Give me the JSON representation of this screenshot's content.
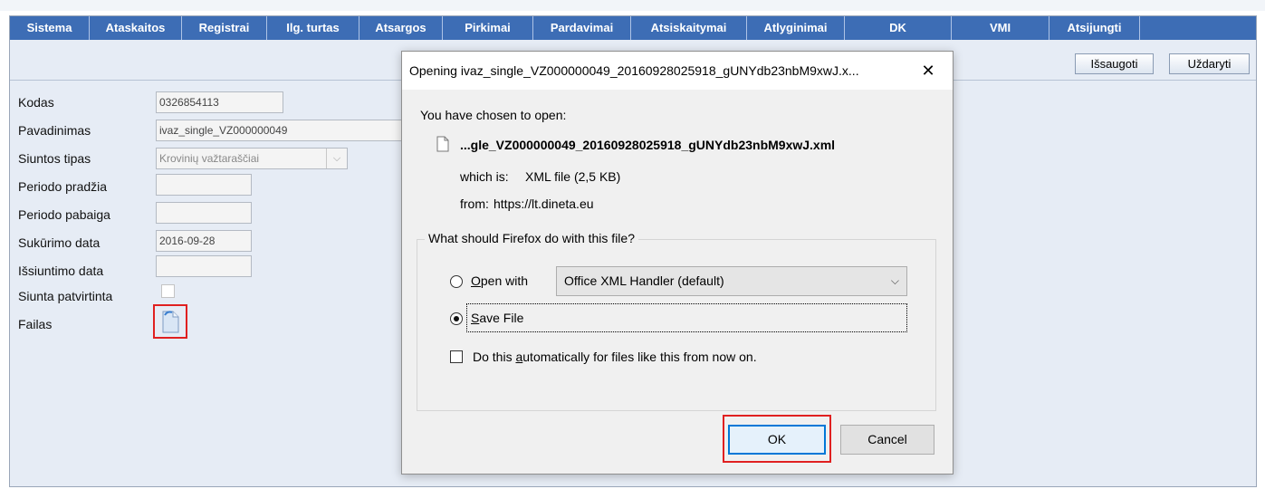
{
  "menu": [
    "Sistema",
    "Ataskaitos",
    "Registrai",
    "Ilg. turtas",
    "Atsargos",
    "Pirkimai",
    "Pardavimai",
    "Atsiskaitymai",
    "Atlyginimai",
    "DK",
    "VMI",
    "Atsijungti"
  ],
  "toolbar": {
    "save_label": "Išsaugoti",
    "close_label": "Uždaryti"
  },
  "form": {
    "kodas_label": "Kodas",
    "kodas_value": "0326854113",
    "pavadinimas_label": "Pavadinimas",
    "pavadinimas_value": "ivaz_single_VZ000000049",
    "siuntos_tipas_label": "Siuntos tipas",
    "siuntos_tipas_value": "Krovinių važtaraščiai",
    "periodo_pradzia_label": "Periodo pradžia",
    "periodo_pabaiga_label": "Periodo pabaiga",
    "sukurimo_data_label": "Sukūrimo data",
    "sukurimo_data_value": "2016-09-28",
    "issiuntimo_data_label": "Išsiuntimo data",
    "siunta_patvirtinta_label": "Siunta patvirtinta",
    "failas_label": "Failas"
  },
  "dialog": {
    "title": "Opening ivaz_single_VZ000000049_20160928025918_gUNYdb23nbM9xwJ.x...",
    "close_glyph": "✕",
    "chosen_text": "You have chosen to open:",
    "file_name": "...gle_VZ000000049_20160928025918_gUNYdb23nbM9xwJ.xml",
    "which_is_label": "which is:",
    "which_is_value": "XML file (2,5 KB)",
    "from_label": "from:",
    "from_value": "https://lt.dineta.eu",
    "question": "What should Firefox do with this file?",
    "open_with_pre": "",
    "open_with_accel": "O",
    "open_with_post": "pen with",
    "handler": "Office XML Handler (default)",
    "save_accel": "S",
    "save_post": "ave File",
    "auto_pre": "Do this ",
    "auto_accel": "a",
    "auto_post": "utomatically for files like this from now on.",
    "ok_label": "OK",
    "cancel_label": "Cancel"
  }
}
